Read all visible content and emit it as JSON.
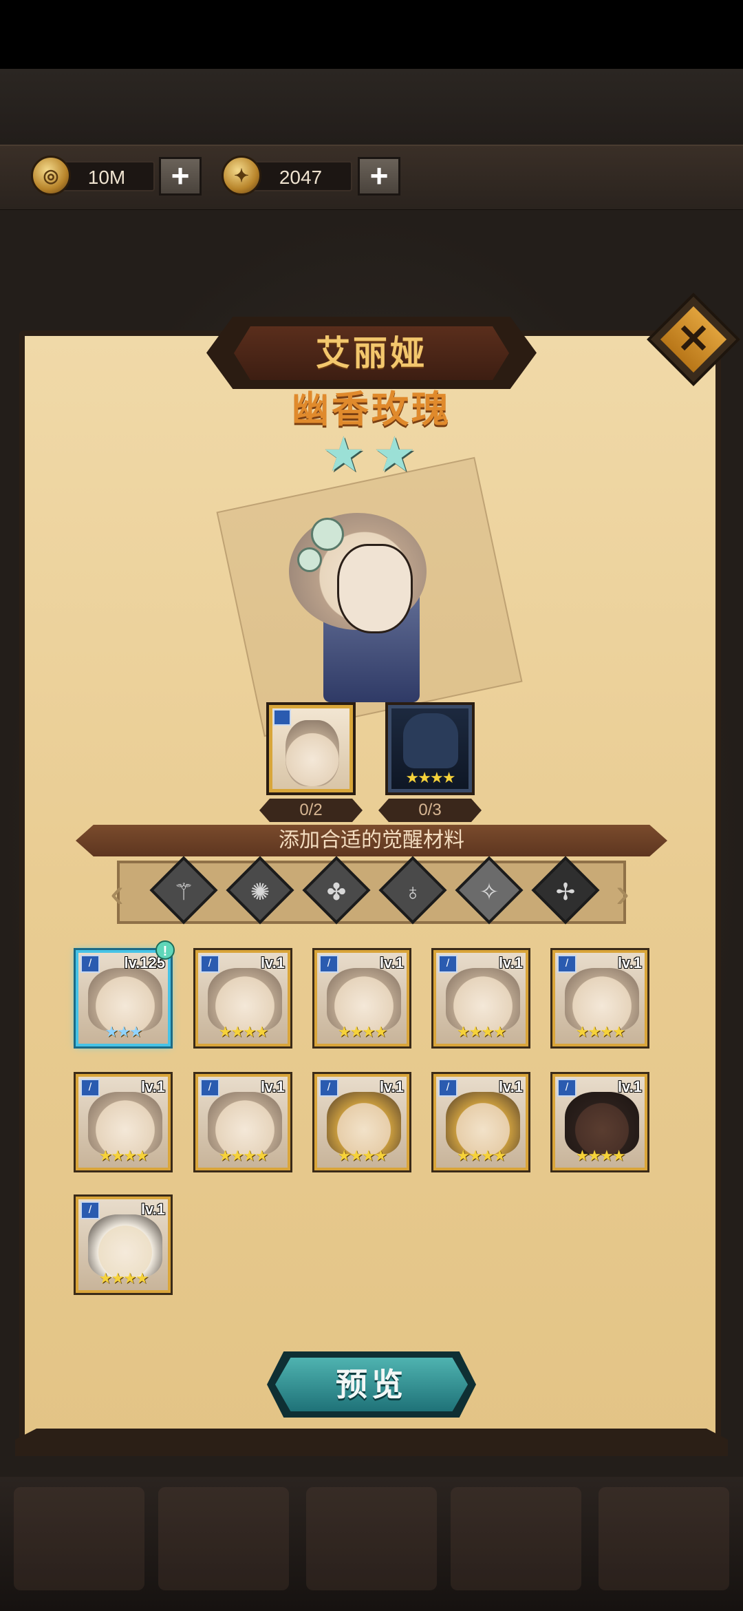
{
  "currency": {
    "gold_amount": "10M",
    "gem_amount": "2047",
    "gold_icon": "gold-coin-icon",
    "gem_icon": "gem-coin-icon"
  },
  "hero": {
    "name": "艾丽娅",
    "title": "幽香玫瑰",
    "star_count": 2
  },
  "awaken": {
    "slot1_count": "0/2",
    "slot2_count": "0/3",
    "slot2_stars": "★★★★",
    "banner_text": "添加合适的觉醒材料"
  },
  "filters": [
    "faction-1-icon",
    "faction-2-icon",
    "faction-3-icon",
    "faction-4-icon",
    "faction-5-icon",
    "faction-6-icon"
  ],
  "heroes": [
    {
      "level": "lv.125",
      "stars": "★★★",
      "style": "light",
      "selected": true,
      "alert": "!"
    },
    {
      "level": "lv.1",
      "stars": "★★★★",
      "style": "light"
    },
    {
      "level": "lv.1",
      "stars": "★★★★",
      "style": "light"
    },
    {
      "level": "lv.1",
      "stars": "★★★★",
      "style": "light"
    },
    {
      "level": "lv.1",
      "stars": "★★★★",
      "style": "light"
    },
    {
      "level": "lv.1",
      "stars": "★★★★",
      "style": "light"
    },
    {
      "level": "lv.1",
      "stars": "★★★★",
      "style": "light"
    },
    {
      "level": "lv.1",
      "stars": "★★★★",
      "style": "gold"
    },
    {
      "level": "lv.1",
      "stars": "★★★★",
      "style": "gold"
    },
    {
      "level": "lv.1",
      "stars": "★★★★",
      "style": "dark"
    },
    {
      "level": "lv.1",
      "stars": "★★★★",
      "style": "blond"
    }
  ],
  "buttons": {
    "preview": "预览",
    "close": "✕",
    "plus": "+"
  }
}
